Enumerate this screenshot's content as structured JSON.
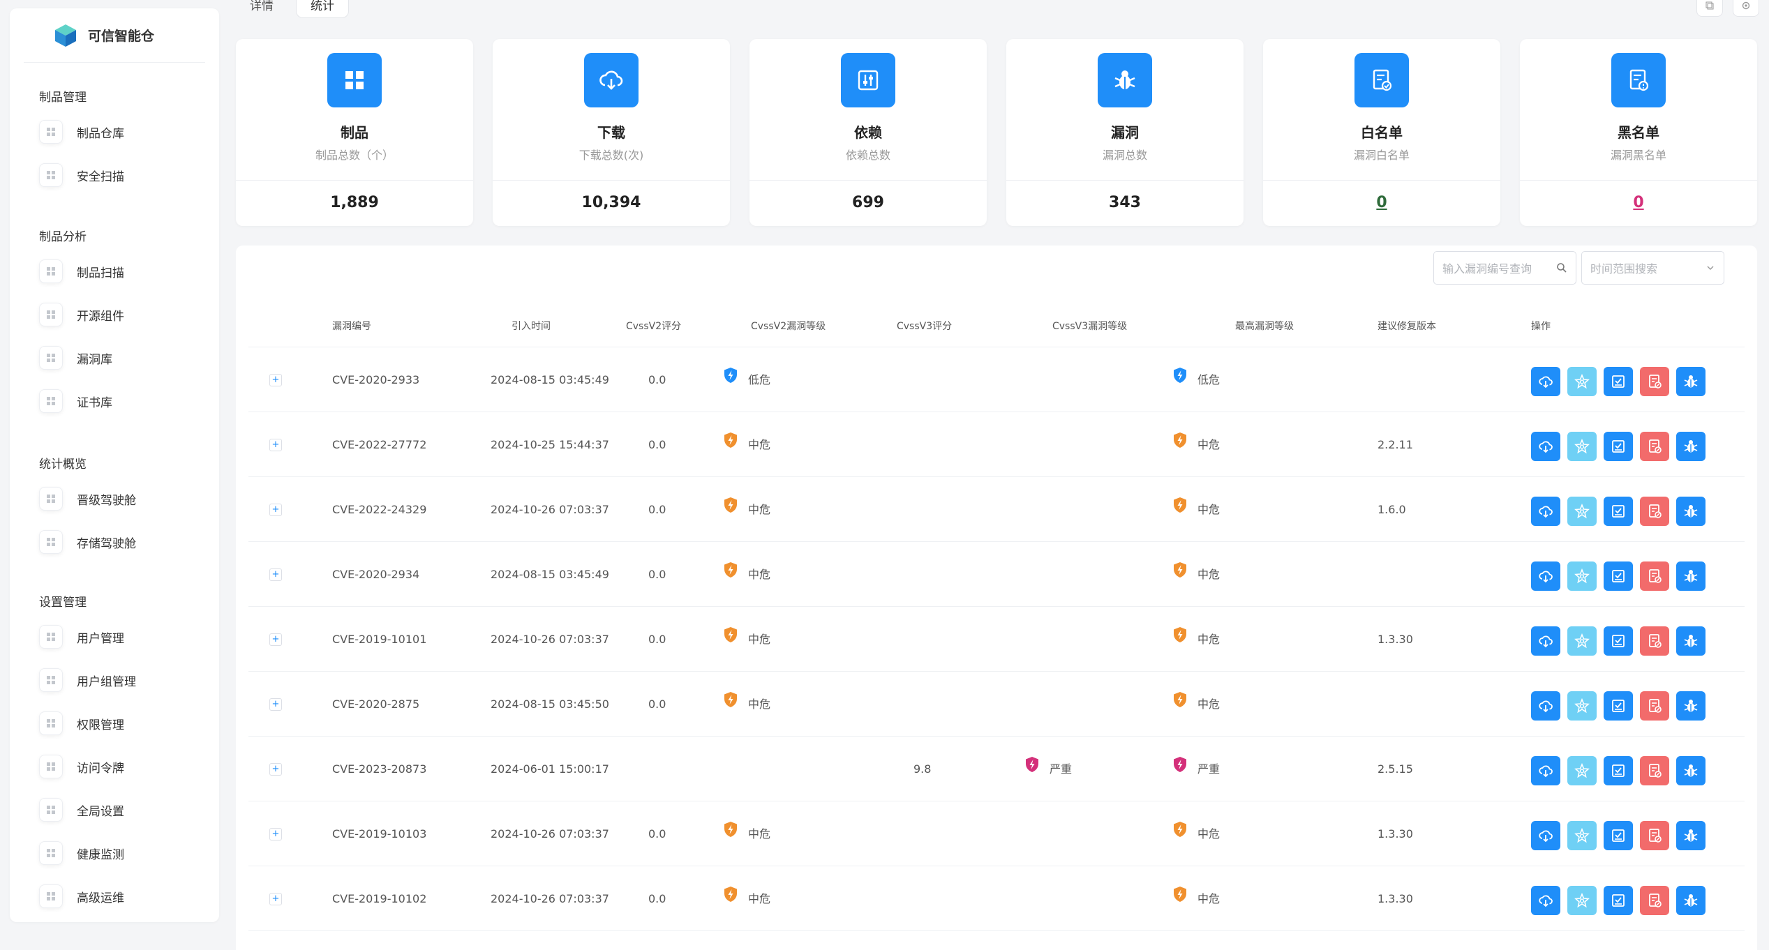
{
  "brand": {
    "name": "可信智能仓"
  },
  "sidebar": {
    "groups": [
      {
        "title": "制品管理",
        "items": [
          {
            "label": "制品仓库",
            "icon": "grid-icon"
          },
          {
            "label": "安全扫描",
            "icon": "id-card-icon"
          }
        ]
      },
      {
        "title": "制品分析",
        "items": [
          {
            "label": "制品扫描",
            "icon": "scan-icon"
          },
          {
            "label": "开源组件",
            "icon": "component-icon"
          },
          {
            "label": "漏洞库",
            "icon": "bug-icon"
          },
          {
            "label": "证书库",
            "icon": "certificate-icon"
          }
        ]
      },
      {
        "title": "统计概览",
        "items": [
          {
            "label": "晋级驾驶舱",
            "icon": "promote-icon"
          },
          {
            "label": "存储驾驶舱",
            "icon": "storage-icon"
          }
        ]
      },
      {
        "title": "设置管理",
        "items": [
          {
            "label": "用户管理",
            "icon": "user-icon"
          },
          {
            "label": "用户组管理",
            "icon": "user-group-icon"
          },
          {
            "label": "权限管理",
            "icon": "permission-icon"
          },
          {
            "label": "访问令牌",
            "icon": "lock-icon"
          },
          {
            "label": "全局设置",
            "icon": "wrench-icon"
          },
          {
            "label": "健康监测",
            "icon": "monitor-icon"
          },
          {
            "label": "高级运维",
            "icon": "ops-icon"
          }
        ]
      }
    ]
  },
  "tabs": [
    {
      "label": "详情"
    },
    {
      "label": "统计"
    }
  ],
  "cards": [
    {
      "title": "制品",
      "sub": "制品总数（个）",
      "value": "1,889",
      "icon": "grid-icon"
    },
    {
      "title": "下载",
      "sub": "下载总数(次)",
      "value": "10,394",
      "icon": "cloud-download-icon"
    },
    {
      "title": "依赖",
      "sub": "依赖总数",
      "value": "699",
      "icon": "dependency-icon"
    },
    {
      "title": "漏洞",
      "sub": "漏洞总数",
      "value": "343",
      "icon": "bug-icon"
    },
    {
      "title": "白名单",
      "sub": "漏洞白名单",
      "value": "0",
      "icon": "whitelist-icon"
    },
    {
      "title": "黑名单",
      "sub": "漏洞黑名单",
      "value": "0",
      "icon": "blacklist-icon"
    }
  ],
  "search": {
    "placeholder": "输入漏洞编号查询",
    "date_placeholder": "时间范围搜索"
  },
  "table": {
    "headers": [
      "漏洞编号",
      "引入时间",
      "CvssV2评分",
      "CvssV2漏洞等级",
      "CvssV3评分",
      "CvssV3漏洞等级",
      "最高漏洞等级",
      "建议修复版本",
      "操作"
    ],
    "rows": [
      {
        "id": "CVE-2020-2933",
        "time": "2024-08-15 03:45:49",
        "v2score": "0.0",
        "v2level": "低危",
        "v3score": "",
        "v3level": "",
        "max": "低危",
        "fix": ""
      },
      {
        "id": "CVE-2022-27772",
        "time": "2024-10-25 15:44:37",
        "v2score": "0.0",
        "v2level": "中危",
        "v3score": "",
        "v3level": "",
        "max": "中危",
        "fix": "2.2.11"
      },
      {
        "id": "CVE-2022-24329",
        "time": "2024-10-26 07:03:37",
        "v2score": "0.0",
        "v2level": "中危",
        "v3score": "",
        "v3level": "",
        "max": "中危",
        "fix": "1.6.0"
      },
      {
        "id": "CVE-2020-2934",
        "time": "2024-08-15 03:45:49",
        "v2score": "0.0",
        "v2level": "中危",
        "v3score": "",
        "v3level": "",
        "max": "中危",
        "fix": ""
      },
      {
        "id": "CVE-2019-10101",
        "time": "2024-10-26 07:03:37",
        "v2score": "0.0",
        "v2level": "中危",
        "v3score": "",
        "v3level": "",
        "max": "中危",
        "fix": "1.3.30"
      },
      {
        "id": "CVE-2020-2875",
        "time": "2024-08-15 03:45:50",
        "v2score": "0.0",
        "v2level": "中危",
        "v3score": "",
        "v3level": "",
        "max": "中危",
        "fix": ""
      },
      {
        "id": "CVE-2023-20873",
        "time": "2024-06-01 15:00:17",
        "v2score": "",
        "v2level": "",
        "v3score": "9.8",
        "v3level": "严重",
        "max": "严重",
        "fix": "2.5.15"
      },
      {
        "id": "CVE-2019-10103",
        "time": "2024-10-26 07:03:37",
        "v2score": "0.0",
        "v2level": "中危",
        "v3score": "",
        "v3level": "",
        "max": "中危",
        "fix": "1.3.30"
      },
      {
        "id": "CVE-2019-10102",
        "time": "2024-10-26 07:03:37",
        "v2score": "0.0",
        "v2level": "中危",
        "v3score": "",
        "v3level": "",
        "max": "中危",
        "fix": "1.3.30"
      }
    ]
  },
  "colors": {
    "accent": "#1f8ef9",
    "low": "#1f8ef9",
    "medium": "#f0902e",
    "critical": "#d4307a",
    "op_light": "#6fd0f5",
    "op_red": "#f26b6b"
  }
}
